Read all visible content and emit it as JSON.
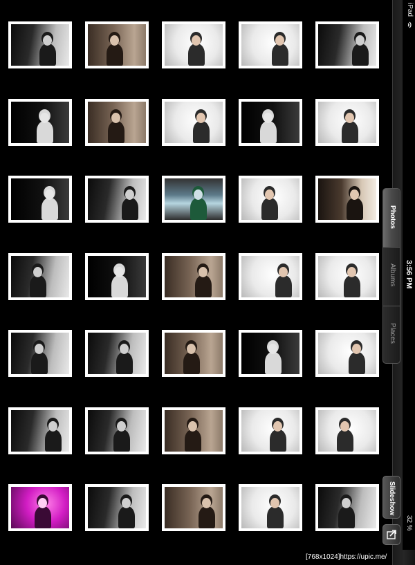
{
  "status": {
    "device": "iPad",
    "time": "3:56 PM",
    "battery": "32 %"
  },
  "tabs": [
    {
      "label": "Photos",
      "active": true
    },
    {
      "label": "Albums",
      "active": false
    },
    {
      "label": "Places",
      "active": false
    }
  ],
  "toolbar": {
    "slideshow_label": "Slideshow"
  },
  "watermark": "[768x1024]https://upic.me/",
  "photos": [
    {
      "tone": "t-bw"
    },
    {
      "tone": "t-sep"
    },
    {
      "tone": "t-lt"
    },
    {
      "tone": "t-lt"
    },
    {
      "tone": "t-bw"
    },
    {
      "tone": "t-dk"
    },
    {
      "tone": "t-sep"
    },
    {
      "tone": "t-lt"
    },
    {
      "tone": "t-dk"
    },
    {
      "tone": "t-lt"
    },
    {
      "tone": "t-dk"
    },
    {
      "tone": "t-bw"
    },
    {
      "tone": "t-scr"
    },
    {
      "tone": "t-lt"
    },
    {
      "tone": "t-brw"
    },
    {
      "tone": "t-bw"
    },
    {
      "tone": "t-dk"
    },
    {
      "tone": "t-sep"
    },
    {
      "tone": "t-lt"
    },
    {
      "tone": "t-lt"
    },
    {
      "tone": "t-bw"
    },
    {
      "tone": "t-bw"
    },
    {
      "tone": "t-sep"
    },
    {
      "tone": "t-dk"
    },
    {
      "tone": "t-lt"
    },
    {
      "tone": "t-bw"
    },
    {
      "tone": "t-bw"
    },
    {
      "tone": "t-sep"
    },
    {
      "tone": "t-lt"
    },
    {
      "tone": "t-lt"
    },
    {
      "tone": "t-pink"
    },
    {
      "tone": "t-bw"
    },
    {
      "tone": "t-sep"
    },
    {
      "tone": "t-lt"
    },
    {
      "tone": "t-bw"
    }
  ]
}
